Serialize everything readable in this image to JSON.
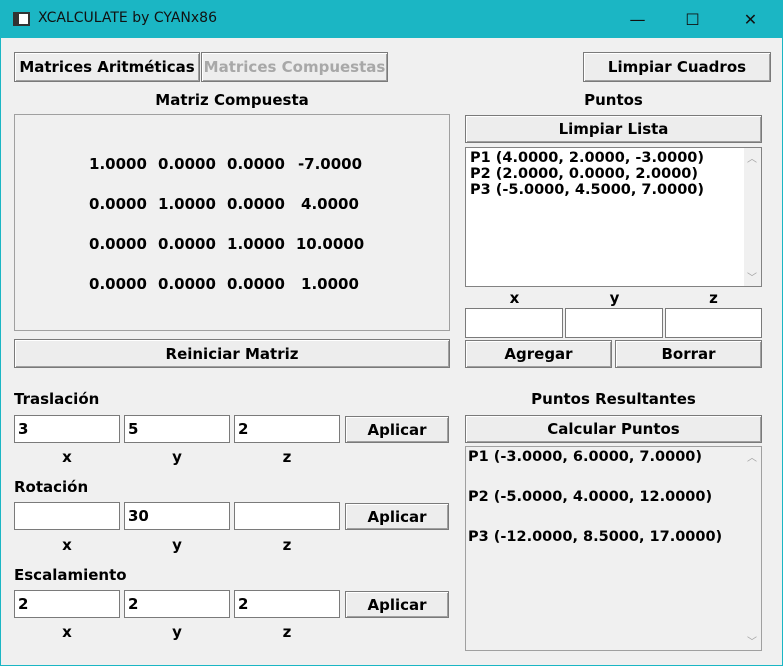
{
  "window": {
    "title": "XCALCULATE by CYANx86",
    "controls": {
      "minimize": "—",
      "maximize": "☐",
      "close": "✕"
    }
  },
  "toolbar": {
    "tab_aritmeticas": "Matrices Aritméticas",
    "tab_compuestas": "Matrices Compuestas",
    "limpiar_cuadros": "Limpiar Cuadros"
  },
  "matrix": {
    "heading": "Matriz Compuesta",
    "rows": [
      [
        "1.0000",
        "0.0000",
        "0.0000",
        "-7.0000"
      ],
      [
        "0.0000",
        "1.0000",
        "0.0000",
        "4.0000"
      ],
      [
        "0.0000",
        "0.0000",
        "1.0000",
        "10.0000"
      ],
      [
        "0.0000",
        "0.0000",
        "0.0000",
        "1.0000"
      ]
    ],
    "reset_label": "Reiniciar Matriz"
  },
  "transforms": {
    "axis_labels": [
      "x",
      "y",
      "z"
    ],
    "apply_label": "Aplicar",
    "traslacion": {
      "label": "Traslación",
      "values": [
        "3",
        "5",
        "2"
      ]
    },
    "rotacion": {
      "label": "Rotación",
      "values": [
        "",
        "30",
        ""
      ]
    },
    "escalamiento": {
      "label": "Escalamiento",
      "values": [
        "2",
        "2",
        "2"
      ]
    }
  },
  "points": {
    "heading": "Puntos",
    "clear_label": "Limpiar Lista",
    "items": [
      "P1 (4.0000, 2.0000, -3.0000)",
      "P2 (2.0000, 0.0000, 2.0000)",
      "P3 (-5.0000, 4.5000, 7.0000)"
    ],
    "axis_labels": [
      "x",
      "y",
      "z"
    ],
    "inputs": [
      "",
      "",
      ""
    ],
    "add_label": "Agregar",
    "delete_label": "Borrar"
  },
  "results": {
    "heading": "Puntos Resultantes",
    "calc_label": "Calcular Puntos",
    "items": [
      "P1 (-3.0000, 6.0000, 7.0000)",
      "P2 (-5.0000, 4.0000, 12.0000)",
      "P3 (-12.0000, 8.5000, 17.0000)"
    ]
  }
}
